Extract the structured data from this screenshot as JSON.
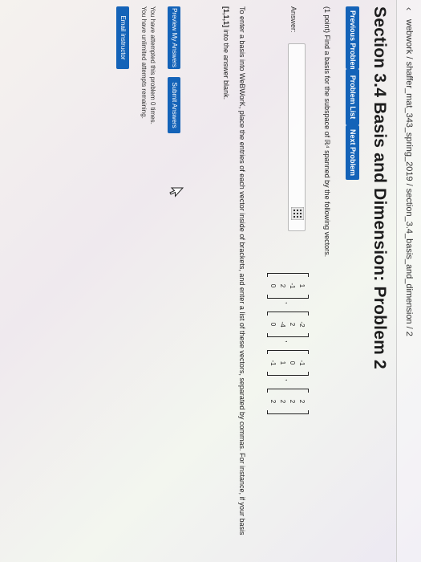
{
  "breadcrumb": {
    "back_icon": "chevron-left-icon",
    "text": "webwork / shaffer_mat_343_spring_2019 / section_3.4_basis_and_dimension / 2"
  },
  "page": {
    "title": "Section 3.4 Basis and Dimension: Problem 2"
  },
  "nav": {
    "previous": "Previous Problem",
    "list": "Problem List",
    "next": "Next Problem"
  },
  "problem": {
    "prompt": "(1 point) Find a basis for the subspace of ℝ⁴ spanned by the following vectors.",
    "vectors": [
      [
        "1",
        "-1",
        "2",
        "0"
      ],
      [
        "-2",
        "2",
        "-4",
        "0"
      ],
      [
        "-1",
        "0",
        "1",
        "-1"
      ],
      [
        "2",
        "2",
        "2",
        "2"
      ]
    ],
    "separator": ","
  },
  "answer": {
    "label": "Answer:",
    "value": "",
    "matrix_icon": "matrix-grid-icon"
  },
  "instructions": {
    "line1": "To enter a basis into WeBWorK, place the entries of each vector inside of brackets, and enter a list of these vectors, separated by commas. For instance, if your basis",
    "example": "[1,1,1]",
    "line2_rest": " into the answer blank."
  },
  "actions": {
    "preview": "Preview My Answers",
    "submit": "Submit Answers",
    "cursor_icon": "mouse-pointer-icon"
  },
  "status": {
    "attempts": "You have attempted this problem 0 times.",
    "remaining": "You have unlimited attempts remaining."
  },
  "email": {
    "label": "Email instructor"
  },
  "colors": {
    "button_blue": "#1463b8"
  }
}
